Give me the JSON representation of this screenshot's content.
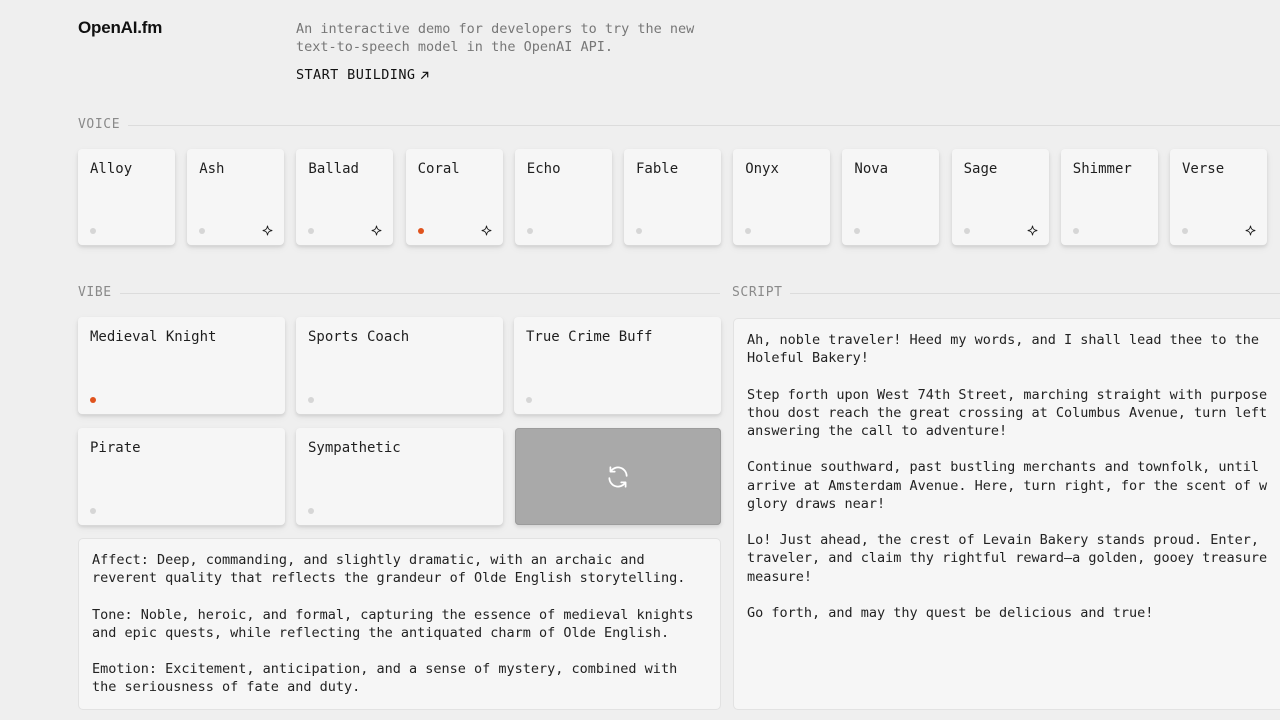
{
  "header": {
    "logo": "OpenAI.fm",
    "intro": "An interactive demo for developers to try the new text-to-speech model in the OpenAI API.",
    "start_building": "START BUILDING"
  },
  "voice": {
    "label": "VOICE",
    "items": [
      {
        "label": "Alloy",
        "selected": false,
        "new": false
      },
      {
        "label": "Ash",
        "selected": false,
        "new": true
      },
      {
        "label": "Ballad",
        "selected": false,
        "new": true
      },
      {
        "label": "Coral",
        "selected": true,
        "new": true
      },
      {
        "label": "Echo",
        "selected": false,
        "new": false
      },
      {
        "label": "Fable",
        "selected": false,
        "new": false
      },
      {
        "label": "Onyx",
        "selected": false,
        "new": false
      },
      {
        "label": "Nova",
        "selected": false,
        "new": false
      },
      {
        "label": "Sage",
        "selected": false,
        "new": true
      },
      {
        "label": "Shimmer",
        "selected": false,
        "new": false
      },
      {
        "label": "Verse",
        "selected": false,
        "new": true
      }
    ]
  },
  "vibe": {
    "label": "VIBE",
    "items": [
      {
        "label": "Medieval Knight",
        "selected": true
      },
      {
        "label": "Sports Coach",
        "selected": false
      },
      {
        "label": "True Crime Buff",
        "selected": false
      },
      {
        "label": "Pirate",
        "selected": false
      },
      {
        "label": "Sympathetic",
        "selected": false
      }
    ],
    "shuffle_icon": "refresh-icon",
    "description": [
      "Affect: Deep, commanding, and slightly dramatic, with an archaic and reverent quality that reflects the grandeur of Olde English storytelling.",
      "Tone: Noble, heroic, and formal, capturing the essence of medieval knights and epic quests, while reflecting the antiquated charm of Olde English.",
      "Emotion: Excitement, anticipation, and a sense of mystery, combined with the seriousness of fate and duty."
    ]
  },
  "script": {
    "label": "SCRIPT",
    "paragraphs": [
      "Ah, noble traveler! Heed my words, and I shall lead thee to the Holeful Bakery!",
      "Step forth upon West 74th Street, marching straight with purpose thou dost reach the great crossing at Columbus Avenue, turn left answering the call to adventure!",
      "Continue southward, past bustling merchants and townfolk, until arrive at Amsterdam Avenue. Here, turn right, for the scent of w glory draws near!",
      "Lo! Just ahead, the crest of Levain Bakery stands proud. Enter, traveler, and claim thy rightful reward—a golden, gooey treasure measure!",
      "Go forth, and may thy quest be delicious and true!"
    ]
  },
  "colors": {
    "accent": "#e0531d",
    "background": "#efefef",
    "card": "#f6f6f6",
    "shuffle": "#a9a9a9"
  }
}
